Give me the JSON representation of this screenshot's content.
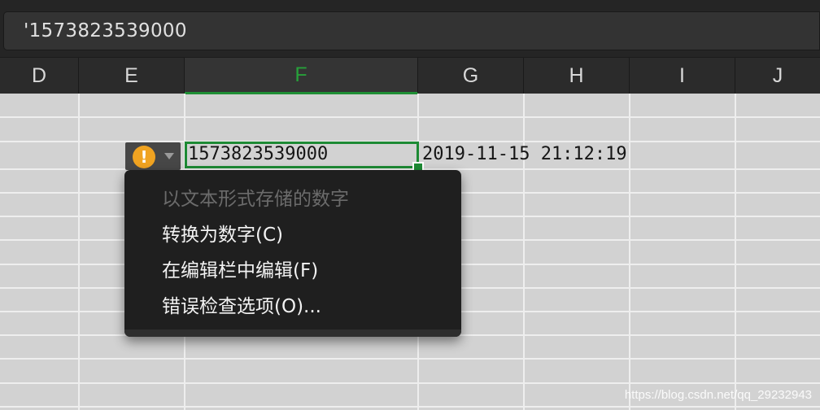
{
  "formula_bar": {
    "value": "'1573823539000"
  },
  "columns": [
    {
      "label": "D",
      "active": false
    },
    {
      "label": "E",
      "active": false
    },
    {
      "label": "F",
      "active": true
    },
    {
      "label": "G",
      "active": false
    },
    {
      "label": "H",
      "active": false
    },
    {
      "label": "I",
      "active": false
    },
    {
      "label": "J",
      "active": false
    }
  ],
  "cells": {
    "f_value": "1573823539000",
    "g_value": "2019-11-15 21:12:19"
  },
  "error_indicator": {
    "icon": "exclamation-icon",
    "glyph": "!",
    "color": "#f0a321"
  },
  "context_menu": {
    "items": [
      {
        "label": "以文本形式存储的数字",
        "enabled": false
      },
      {
        "label": "转换为数字(C)",
        "enabled": true
      },
      {
        "label": "在编辑栏中编辑(F)",
        "enabled": true
      },
      {
        "label": "错误检查选项(O)...",
        "enabled": true
      }
    ]
  },
  "watermark": "https://blog.csdn.net/qq_29232943",
  "colors": {
    "accent": "#1d8a34",
    "header_bg": "#2b2b2b",
    "grid_bg": "#d2d2d2"
  }
}
